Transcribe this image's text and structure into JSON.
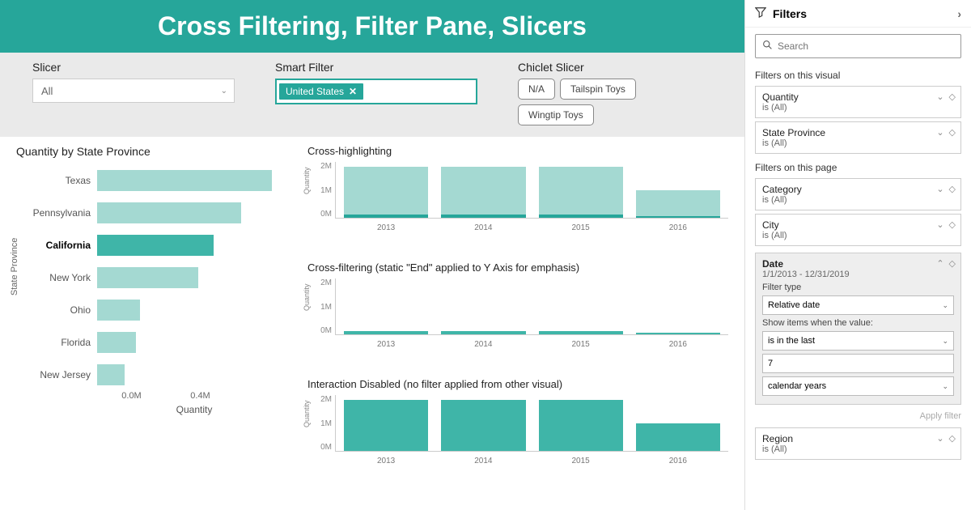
{
  "title": "Cross Filtering, Filter Pane, Slicers",
  "slicers": {
    "slicer": {
      "label": "Slicer",
      "value": "All"
    },
    "smart": {
      "label": "Smart Filter",
      "chip": "United States"
    },
    "chiclet": {
      "label": "Chiclet Slicer",
      "items": [
        "N/A",
        "Tailspin Toys",
        "Wingtip Toys"
      ]
    }
  },
  "chart_data": [
    {
      "type": "bar",
      "orientation": "horizontal",
      "title": "Quantity by State Province",
      "xlabel": "Quantity",
      "ylabel": "State Province",
      "x_ticks": [
        "0.0M",
        "0.4M"
      ],
      "categories": [
        "Texas",
        "Pennsylvania",
        "California",
        "New York",
        "Ohio",
        "Florida",
        "New Jersey"
      ],
      "values": [
        0.45,
        0.37,
        0.3,
        0.26,
        0.11,
        0.1,
        0.07
      ],
      "selected": "California",
      "xlim": [
        0,
        0.5
      ],
      "unit": "millions"
    },
    {
      "type": "bar",
      "title": "Cross-highlighting",
      "ylabel": "Quantity",
      "ylim": [
        0,
        2.4
      ],
      "y_ticks": [
        "2M",
        "1M",
        "0M"
      ],
      "categories": [
        "2013",
        "2014",
        "2015",
        "2016"
      ],
      "series": [
        {
          "name": "total",
          "values": [
            2.2,
            2.2,
            2.2,
            1.2
          ],
          "style": "light"
        },
        {
          "name": "highlighted",
          "values": [
            0.15,
            0.15,
            0.15,
            0.08
          ],
          "style": "overlay"
        }
      ]
    },
    {
      "type": "bar",
      "title": "Cross-filtering (static \"End\" applied to Y Axis for emphasis)",
      "ylabel": "Quantity",
      "ylim": [
        0,
        2.4
      ],
      "y_ticks": [
        "2M",
        "1M",
        "0M"
      ],
      "categories": [
        "2013",
        "2014",
        "2015",
        "2016"
      ],
      "series": [
        {
          "name": "filtered",
          "values": [
            0.15,
            0.15,
            0.15,
            0.08
          ],
          "style": "dark"
        }
      ]
    },
    {
      "type": "bar",
      "title": "Interaction Disabled (no filter applied from other visual)",
      "ylabel": "Quantity",
      "ylim": [
        0,
        2.4
      ],
      "y_ticks": [
        "2M",
        "1M",
        "0M"
      ],
      "categories": [
        "2013",
        "2014",
        "2015",
        "2016"
      ],
      "series": [
        {
          "name": "all",
          "values": [
            2.2,
            2.2,
            2.2,
            1.2
          ],
          "style": "dark"
        }
      ]
    }
  ],
  "filter_pane": {
    "title": "Filters",
    "search_placeholder": "Search",
    "sections": {
      "visual": {
        "label": "Filters on this visual",
        "cards": [
          {
            "title": "Quantity",
            "sub": "is (All)"
          },
          {
            "title": "State Province",
            "sub": "is (All)"
          }
        ]
      },
      "page": {
        "label": "Filters on this page",
        "cards": [
          {
            "title": "Category",
            "sub": "is (All)"
          },
          {
            "title": "City",
            "sub": "is (All)"
          }
        ]
      }
    },
    "date_card": {
      "title": "Date",
      "sub": "1/1/2013 - 12/31/2019",
      "filter_type_label": "Filter type",
      "filter_type": "Relative date",
      "show_label": "Show items when the value:",
      "cond": "is in the last",
      "num": "7",
      "unit": "calendar years",
      "apply": "Apply filter"
    },
    "region": {
      "title": "Region",
      "sub": "is (All)"
    }
  }
}
